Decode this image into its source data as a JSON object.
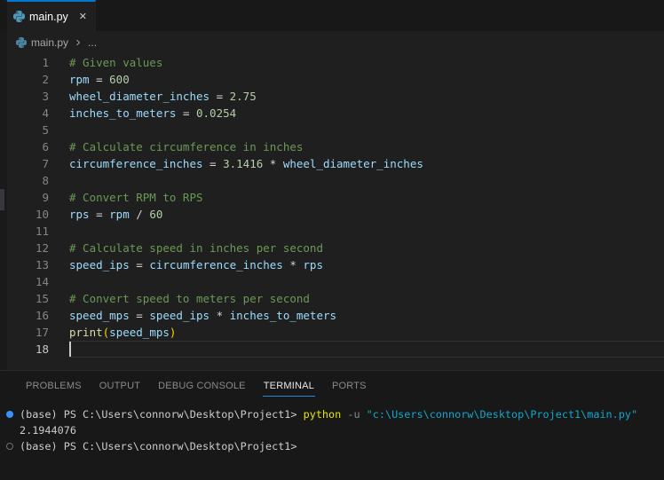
{
  "tab_bar": {
    "tabs": [
      {
        "label": "main.py",
        "icon": "python-file-icon",
        "close_glyph": "✕",
        "active": true
      }
    ]
  },
  "breadcrumb": {
    "icon": "python-file-icon",
    "file": "main.py",
    "ellipsis": "..."
  },
  "editor": {
    "language": "python",
    "lines": [
      {
        "n": 1,
        "tokens": [
          [
            "comment",
            "# Given values"
          ]
        ]
      },
      {
        "n": 2,
        "tokens": [
          [
            "variable",
            "rpm"
          ],
          [
            "operator",
            " = "
          ],
          [
            "number",
            "600"
          ]
        ]
      },
      {
        "n": 3,
        "tokens": [
          [
            "variable",
            "wheel_diameter_inches"
          ],
          [
            "operator",
            " = "
          ],
          [
            "number",
            "2.75"
          ]
        ]
      },
      {
        "n": 4,
        "tokens": [
          [
            "variable",
            "inches_to_meters"
          ],
          [
            "operator",
            " = "
          ],
          [
            "number",
            "0.0254"
          ]
        ]
      },
      {
        "n": 5,
        "tokens": []
      },
      {
        "n": 6,
        "tokens": [
          [
            "comment",
            "# Calculate circumference in inches"
          ]
        ]
      },
      {
        "n": 7,
        "tokens": [
          [
            "variable",
            "circumference_inches"
          ],
          [
            "operator",
            " = "
          ],
          [
            "number",
            "3.1416"
          ],
          [
            "operator",
            " * "
          ],
          [
            "variable",
            "wheel_diameter_inches"
          ]
        ]
      },
      {
        "n": 8,
        "tokens": []
      },
      {
        "n": 9,
        "tokens": [
          [
            "comment",
            "# Convert RPM to RPS"
          ]
        ]
      },
      {
        "n": 10,
        "tokens": [
          [
            "variable",
            "rps"
          ],
          [
            "operator",
            " = "
          ],
          [
            "variable",
            "rpm"
          ],
          [
            "operator",
            " / "
          ],
          [
            "number",
            "60"
          ]
        ]
      },
      {
        "n": 11,
        "tokens": []
      },
      {
        "n": 12,
        "tokens": [
          [
            "comment",
            "# Calculate speed in inches per second"
          ]
        ]
      },
      {
        "n": 13,
        "tokens": [
          [
            "variable",
            "speed_ips"
          ],
          [
            "operator",
            " = "
          ],
          [
            "variable",
            "circumference_inches"
          ],
          [
            "operator",
            " * "
          ],
          [
            "variable",
            "rps"
          ]
        ]
      },
      {
        "n": 14,
        "tokens": []
      },
      {
        "n": 15,
        "tokens": [
          [
            "comment",
            "# Convert speed to meters per second"
          ]
        ]
      },
      {
        "n": 16,
        "tokens": [
          [
            "variable",
            "speed_mps"
          ],
          [
            "operator",
            " = "
          ],
          [
            "variable",
            "speed_ips"
          ],
          [
            "operator",
            " * "
          ],
          [
            "variable",
            "inches_to_meters"
          ]
        ]
      },
      {
        "n": 17,
        "tokens": [
          [
            "function",
            "print"
          ],
          [
            "bracket",
            "("
          ],
          [
            "variable",
            "speed_mps"
          ],
          [
            "bracket",
            ")"
          ]
        ]
      },
      {
        "n": 18,
        "tokens": [],
        "current": true
      }
    ]
  },
  "panel": {
    "tabs": [
      {
        "label": "PROBLEMS",
        "active": false
      },
      {
        "label": "OUTPUT",
        "active": false
      },
      {
        "label": "DEBUG CONSOLE",
        "active": false
      },
      {
        "label": "TERMINAL",
        "active": true
      },
      {
        "label": "PORTS",
        "active": false
      }
    ],
    "terminal": {
      "lines": [
        {
          "decoration": "command-run",
          "tokens": [
            [
              "text",
              "(base) PS C:\\Users\\connorw\\Desktop\\Project1> "
            ],
            [
              "command",
              "python"
            ],
            [
              "text",
              " "
            ],
            [
              "parameter",
              "-u"
            ],
            [
              "text",
              " "
            ],
            [
              "string",
              "\"c:\\Users\\connorw\\Desktop\\Project1\\main.py\""
            ]
          ]
        },
        {
          "decoration": null,
          "tokens": [
            [
              "text",
              "2.1944076"
            ]
          ]
        },
        {
          "decoration": "prompt",
          "tokens": [
            [
              "text",
              "(base) PS C:\\Users\\connorw\\Desktop\\Project1>"
            ]
          ]
        }
      ]
    }
  },
  "token_colors": {
    "comment": "#6A9955",
    "variable": "#9CDCFE",
    "operator": "#D4D4D4",
    "number": "#B5CEA8",
    "function": "#DCDCAA",
    "bracket": "#FFD700",
    "text": "#CCCCCC",
    "command": "#E5E510",
    "parameter": "#8A8A8A",
    "string": "#11A8CD"
  },
  "accent_colors": {
    "active_tab_top_border": "#0078D4",
    "panel_active_underline": "#2488DB",
    "terminal_decoration_blue": "#3794FF",
    "python_icon_blue": "#519ABA"
  }
}
